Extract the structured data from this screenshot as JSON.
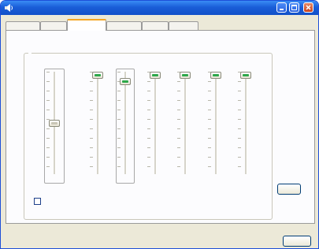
{
  "window": {
    "title": "",
    "accent_color": "#1a5ed8",
    "app_icon": "speaker-icon",
    "caption_buttons": [
      "minimize-icon",
      "maximize-icon",
      "close-icon"
    ]
  },
  "tabs": [
    {
      "label": "",
      "selected": false
    },
    {
      "label": "",
      "selected": false
    },
    {
      "label": "",
      "selected": true
    },
    {
      "label": "",
      "selected": false
    },
    {
      "label": "",
      "selected": false
    },
    {
      "label": "",
      "selected": false
    }
  ],
  "volume_group": {
    "legend": "",
    "master": {
      "level": 0.5,
      "db_label": "",
      "checkbox_label": "",
      "checked": false
    },
    "channels": [
      {
        "label": "",
        "db_label": "",
        "level": 1.0,
        "selected": false
      },
      {
        "label": "",
        "db_label": "",
        "level": 0.93,
        "selected": true
      },
      {
        "label": "",
        "db_label": "",
        "level": 1.0,
        "selected": false
      },
      {
        "label": "",
        "db_label": "",
        "level": 1.0,
        "selected": false
      },
      {
        "label": "",
        "db_label": "",
        "level": 1.0,
        "selected": false
      },
      {
        "label": "",
        "db_label": "",
        "level": 1.0,
        "selected": false
      }
    ]
  },
  "buttons": {
    "default_label": "",
    "ok_label": ""
  },
  "colors": {
    "level_indicator": "#2ea84a",
    "group_legend": "#1d3fb5"
  }
}
